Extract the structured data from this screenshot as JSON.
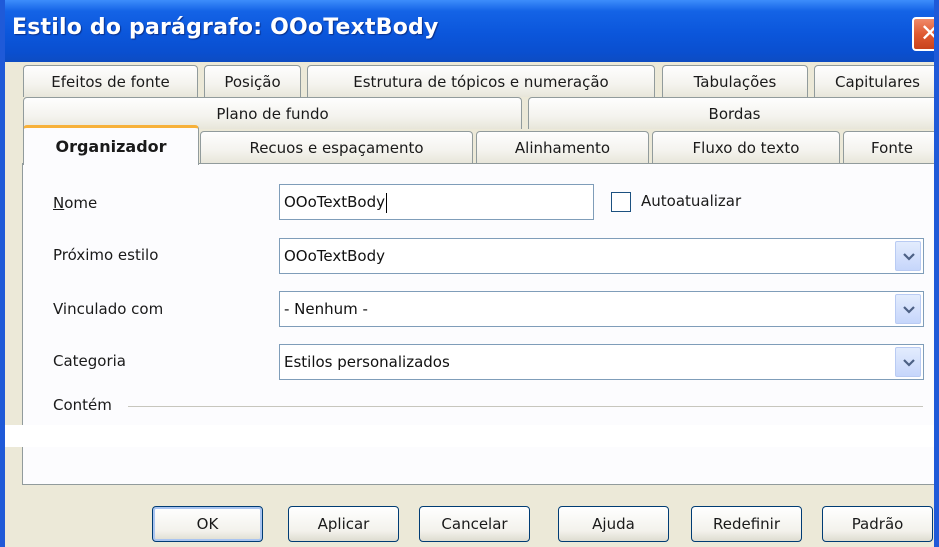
{
  "window": {
    "title": "Estilo do parágrafo: OOoTextBody",
    "close_glyph": "✕"
  },
  "tabs": {
    "row1": [
      "Efeitos de fonte",
      "Posição",
      "Estrutura de tópicos e numeração",
      "Tabulações",
      "Capitulares"
    ],
    "row2": [
      "Plano de fundo",
      "Bordas"
    ],
    "row3": [
      "Organizador",
      "Recuos e espaçamento",
      "Alinhamento",
      "Fluxo do texto",
      "Fonte"
    ],
    "active": "Organizador"
  },
  "form": {
    "name_label": "Nome",
    "name_value": "OOoTextBody",
    "autoupdate_label": "Autoatualizar",
    "autoupdate_checked": false,
    "next_style_label": "Próximo estilo",
    "next_style_value": "OOoTextBody",
    "linked_label": "Vinculado com",
    "linked_value": "- Nenhum -",
    "category_label": "Categoria",
    "category_value": "Estilos personalizados",
    "contains_label": "Contém"
  },
  "buttons": {
    "ok": "OK",
    "apply": "Aplicar",
    "cancel": "Cancelar",
    "help": "Ajuda",
    "reset": "Redefinir",
    "standard": "Padrão"
  },
  "colors": {
    "titlebar": "#0b56db",
    "dialog_bg": "#ece9d8",
    "active_tab_accent": "#f7b13a",
    "close_button": "#df5a32"
  },
  "icons": {
    "close": "close-icon",
    "dropdown": "chevron-down-icon"
  }
}
